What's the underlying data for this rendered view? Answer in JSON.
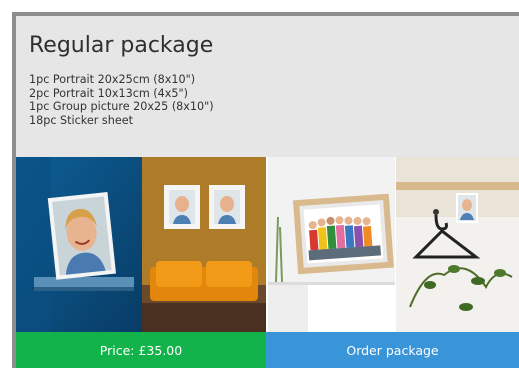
{
  "package": {
    "title": "Regular package",
    "items": [
      "1pc Portrait 20x25cm (8x10\")",
      "2pc Portrait 10x13cm (4x5\")",
      "1pc Group picture 20x25 (8x10\")",
      "18pc Sticker sheet"
    ],
    "photos": [
      "shelf-portrait-photo",
      "wall-frames-photo",
      "group-frame-photo",
      "hanger-photo"
    ]
  },
  "buttons": {
    "price_label": "Price: £35.00",
    "order_label": "Order package"
  },
  "colors": {
    "price_button": "#13b34b",
    "order_button": "#3a94d8",
    "card_background": "#e6e6e6"
  }
}
